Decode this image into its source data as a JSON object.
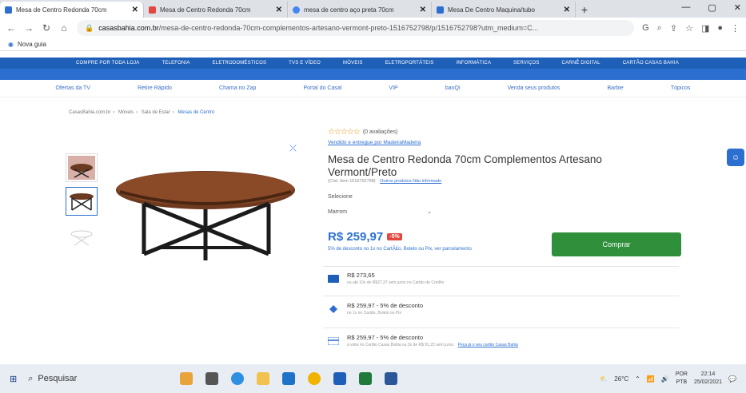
{
  "browser": {
    "tabs": [
      {
        "title": "Mesa de Centro Redonda 70cm",
        "favicon_color": "#2d6fd0",
        "active": true
      },
      {
        "title": "Mesa de Centro Redonda 70cm",
        "favicon_color": "#e2483d",
        "active": false
      },
      {
        "title": "mesa de centro aço preta 70cm",
        "favicon_color": "#4285f4",
        "active": false
      },
      {
        "title": "Mesa De Centro Maquina/tubo",
        "favicon_color": "#2d6fd0",
        "active": false
      }
    ],
    "new_tab": "+",
    "url_domain": "casasbahia.com.br",
    "url_path": "/mesa-de-centro-redonda-70cm-complementos-artesano-vermont-preto-1516752798/p/1516752798?utm_medium=C...",
    "bookmark": "Nova guia"
  },
  "site": {
    "departments": [
      "COMPRE POR TODA LOJA",
      "TELEFONIA",
      "ELETRODOMÉSTICOS",
      "TVS E VÍDEO",
      "MÓVEIS",
      "ELETROPORTÁTEIS",
      "INFORMÁTICA",
      "SERVIÇOS",
      "CARNÊ DIGITAL",
      "CARTÃO CASAS BAHIA"
    ],
    "subnav": [
      "Ofertas da TV",
      "Retire Rápido",
      "Chama no Zap",
      "Portal do Casal",
      "VIP",
      "banQi",
      "Venda seus produtos",
      "Barbie",
      "Tópicos"
    ],
    "breadcrumb": [
      "CasasBahia.com.br",
      "Móveis",
      "Sala de Estar",
      "Mesas de Centro"
    ]
  },
  "product": {
    "stars": "☆☆☆☆☆",
    "reviews": "(0 avaliações)",
    "seller": "Vendido e entregue por MadeiraMadeira",
    "title": "Mesa de Centro Redonda 70cm Complementos Artesano Vermont/Preto",
    "code": "(Cód. Item 1516752798)",
    "other_products": "Outros produtos Não informado",
    "select_label": "Selecione",
    "select_value": "Marrom",
    "price": "R$ 259,97",
    "discount": "-5%",
    "pix_note": "5% de desconto no 1x no CartÃ£o, Boleto ou Pix, ver parcelamento",
    "buy_label": "Comprar",
    "payments": [
      {
        "main": "R$ 273,65",
        "sub": "ou até 10x de R$27,37 sem juros no Cartão de Crédito",
        "link": "",
        "icon_color": "#1e5fb8"
      },
      {
        "main": "R$ 259,97 - 5% de desconto",
        "sub": "no 1x no Cartão, Boleto ou Pix",
        "link": "",
        "icon_color": "#2d6fd0"
      },
      {
        "main": "R$ 259,97 - 5% de desconto",
        "sub": "à vista no Cartão Casas Bahia ou 3x de R$ 91,22 sem juros.",
        "link": "Peça já o seu cartão Casas Bahia",
        "icon_color": "#5a8fe0"
      }
    ]
  },
  "taskbar": {
    "search": "Pesquisar",
    "weather": "26°C",
    "lang_top": "POR",
    "lang_bottom": "PTB",
    "time": "22:14",
    "date": "25/02/2021"
  },
  "colors": {
    "brand_blue": "#2d6fd0",
    "buy_green": "#2f8f3b",
    "discount_red": "#e2483d"
  }
}
